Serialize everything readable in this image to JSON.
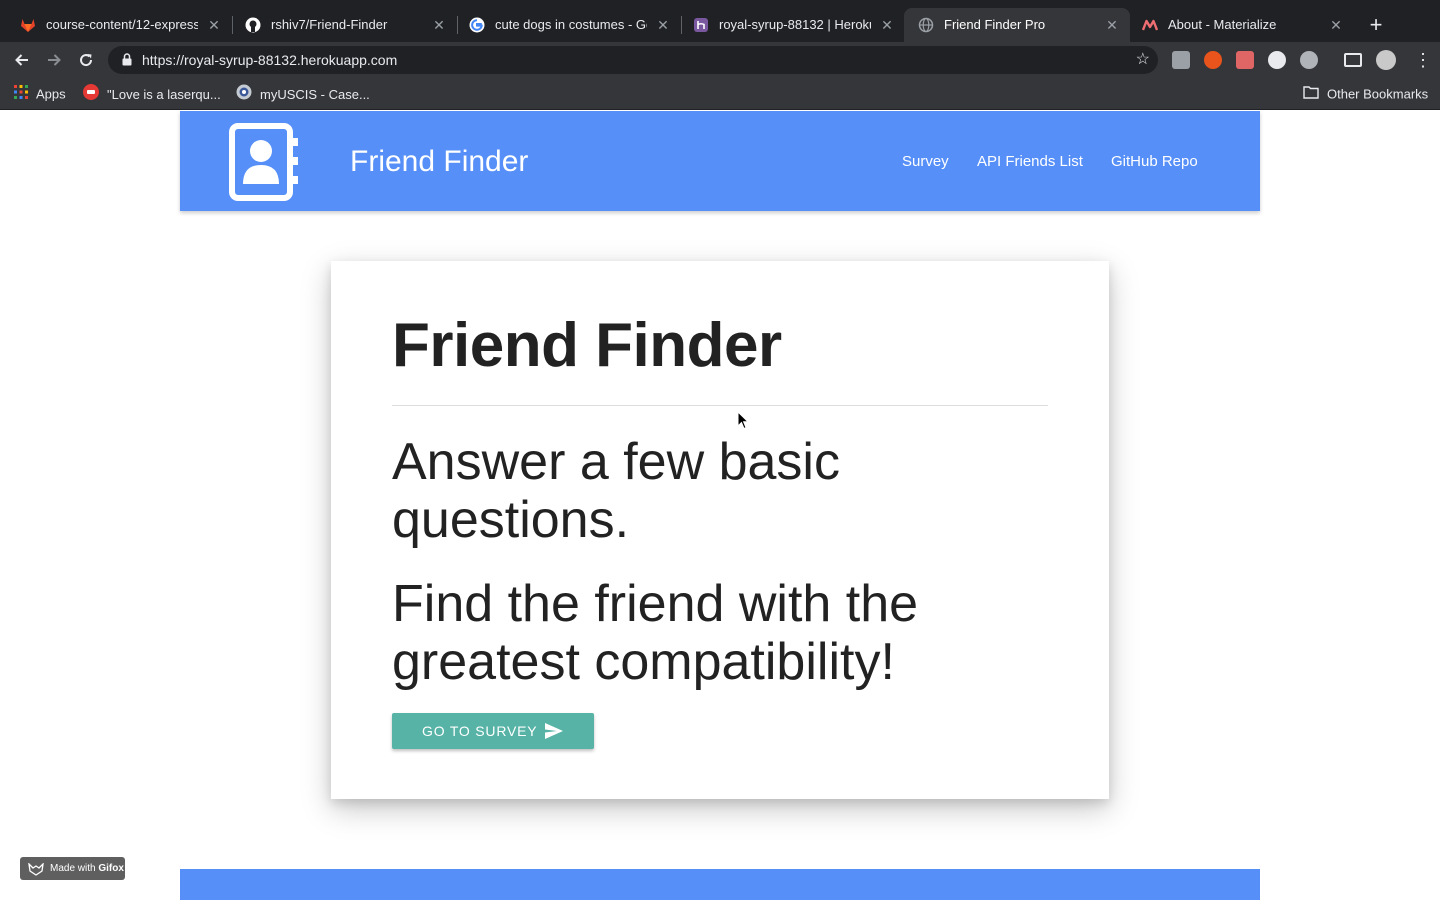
{
  "browser": {
    "tabs": [
      {
        "title": "course-content/12-express/",
        "icon": "gitlab-icon",
        "active": false
      },
      {
        "title": "rshiv7/Friend-Finder",
        "icon": "github-icon",
        "active": false
      },
      {
        "title": "cute dogs in costumes - Goo",
        "icon": "google-icon",
        "active": false
      },
      {
        "title": "royal-syrup-88132 | Heroku",
        "icon": "heroku-icon",
        "active": false
      },
      {
        "title": "Friend Finder Pro",
        "icon": "globe-icon",
        "active": true
      },
      {
        "title": "About - Materialize",
        "icon": "materialize-icon",
        "active": false
      }
    ],
    "url": "https://royal-syrup-88132.herokuapp.com",
    "bookmarks": [
      {
        "label": "Apps",
        "icon": "apps-grid-icon"
      },
      {
        "label": "\"Love is a laserqu...",
        "icon": "bookmark-favicon-icon"
      },
      {
        "label": "myUSCIS - Case...",
        "icon": "uscis-seal-icon"
      }
    ],
    "other_bookmarks": "Other Bookmarks",
    "colors": {
      "tabstrip": "#202124",
      "toolbar": "#35363a"
    }
  },
  "site": {
    "brand": "Friend Finder",
    "nav_links": [
      "Survey",
      "API Friends List",
      "GitHub Repo"
    ],
    "colors": {
      "primary": "#568ff7",
      "button": "#56b3a6"
    }
  },
  "card": {
    "title": "Friend Finder",
    "line1": "Answer a few basic questions.",
    "line2": "Find the friend with the greatest compatibility!",
    "button_label": "GO TO SURVEY"
  },
  "watermark": {
    "prefix": "Made with",
    "brand": "Gifox"
  }
}
